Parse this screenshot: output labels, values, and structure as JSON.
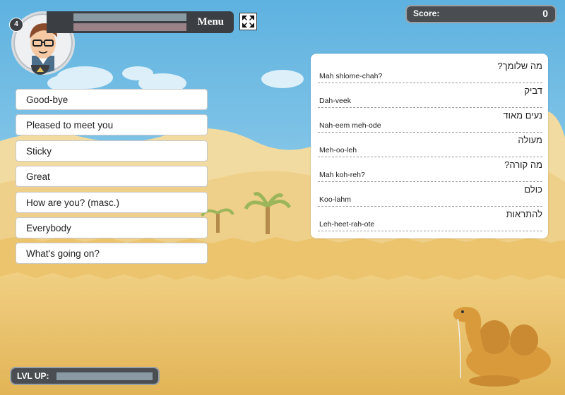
{
  "player": {
    "level": "4",
    "avatar_icon": "cartoon-man-with-glasses"
  },
  "hud": {
    "menu_label": "Menu",
    "fullscreen_icon": "fullscreen-arrows-icon"
  },
  "score": {
    "label": "Score:",
    "value": "0"
  },
  "english_cards": [
    "Good-bye",
    "Pleased to meet you",
    "Sticky",
    "Great",
    "How are you? (masc.)",
    "Everybody",
    "What's going on?"
  ],
  "hebrew_entries": [
    {
      "hebrew": "מה שלומך?",
      "transliteration": "Mah shlome-chah?"
    },
    {
      "hebrew": "דביק",
      "transliteration": "Dah-veek"
    },
    {
      "hebrew": "נעים מאוד",
      "transliteration": "Nah-eem meh-ode"
    },
    {
      "hebrew": "מעולה",
      "transliteration": "Meh-oo-leh"
    },
    {
      "hebrew": "מה קורה?",
      "transliteration": "Mah koh-reh?"
    },
    {
      "hebrew": "כולם",
      "transliteration": "Koo-lahm"
    },
    {
      "hebrew": "להתראות",
      "transliteration": "Leh-heet-rah-ote"
    }
  ],
  "level_up": {
    "label": "LVL UP:"
  },
  "colors": {
    "sky": "#7ec3e6",
    "sand": "#e8bd62",
    "hud_dark": "#3b3f44"
  }
}
